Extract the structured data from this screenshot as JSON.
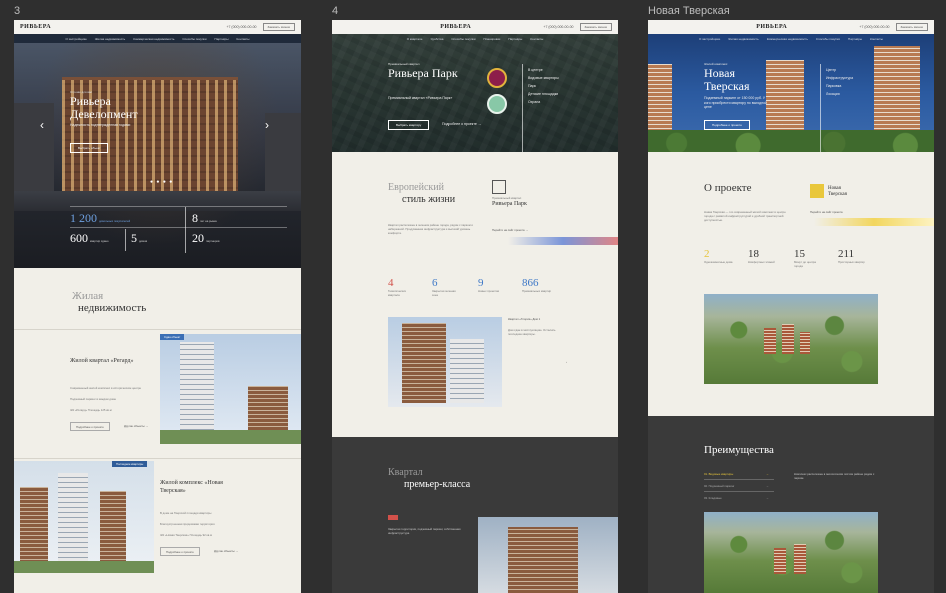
{
  "columns": [
    {
      "number": "3",
      "header": {
        "logo": "РИВЬЕРА"
      },
      "nav": [
        "О застройщике",
        "Жилая недвижимость",
        "Коммерческая недвижимость",
        "Способы покупки",
        "Партнёры",
        "Контакты"
      ],
      "hero": {
        "kicker": "Строим для вас",
        "title": "Ривьера Девелопмент",
        "subtitle": "Надежность подтвержденная годами",
        "button": "Выбрать объект",
        "arrow_left": "‹",
        "arrow_right": "›",
        "dots": "● ● ● ●"
      },
      "stats": [
        {
          "num": "1 200",
          "label": "довольных покупателей",
          "blue": true
        },
        {
          "num": "8",
          "label": "лет на рынке"
        },
        {
          "num": "600",
          "label": "квартир сдано"
        },
        {
          "num": "5",
          "label": "домов"
        },
        {
          "num": "20",
          "label": "партнеров"
        }
      ],
      "section": {
        "line1": "Жилая",
        "line2": "недвижимость"
      },
      "cards": [
        {
          "tag": "Сдан объект",
          "title": "Жилой квартал «Регард»",
          "bullets": [
            "Современный жилой комплекс в историческом центре",
            "Подземный паркинг в каждом доме",
            "ЖК «Регард» Площадь 125 кв.м"
          ],
          "button": "Подробнее о проекте",
          "more": "Другие объекты →"
        },
        {
          "tag": "Последние квартиры",
          "title": "Жилой комплекс «Новая Тверская»",
          "bullets": [
            "В доме на Тверской площади квартиры",
            "Благоустроенная придомовая территория",
            "ЖК «Новая Тверская» Площадь 92 кв.м"
          ],
          "button": "Подробнее о проекте",
          "more": "Другие объекты →"
        }
      ]
    },
    {
      "number": "4",
      "header": {
        "logo": "РИВЬЕРА"
      },
      "nav": [
        "О квартале",
        "Удобства",
        "Способы покупки",
        "Планировки",
        "Партнёры",
        "Контакты"
      ],
      "hero": {
        "kicker": "Премиальный квартал",
        "title": "Ривьера Парк",
        "subtitle": "Премиальный квартал «Ривьера Парк»",
        "button": "Выбрать квартиру",
        "link": "Подробнее о проекте →",
        "features": [
          "В центре",
          "Видовые квартиры",
          "Парк",
          "Детские площадки",
          "Охрана"
        ]
      },
      "section": {
        "line1": "Европейский",
        "line2": "стиль жизни",
        "logo_kicker": "Премиальный квартал",
        "logo_name": "Ривьера Парк",
        "link": "Перейти на сайт проекта →",
        "para": "Квартал расположен в зеленом районе города, рядом с парком и набережной. Продуманная инфраструктура и высокий уровень комфорта."
      },
      "stats": [
        {
          "num": "4",
          "label": "Тематических квартала",
          "color": "#d2514a"
        },
        {
          "num": "6",
          "label": "Закрытая зеленая зона",
          "color": "#3e78c7"
        },
        {
          "num": "9",
          "label": "Новых проектов",
          "color": "#3e78c7"
        },
        {
          "num": "866",
          "label": "Премиальных квартир",
          "color": "#3e78c7"
        }
      ],
      "house": {
        "title": "Квартал «Глория» Дом 1",
        "text": "Дом сдан в эксплуатацию. Остались последние квартиры."
      },
      "dark": {
        "line1": "Квартал",
        "line2": "премьер-класса",
        "para": "Закрытая территория, подземный паркинг, собственная инфраструктура."
      }
    },
    {
      "number": "Новая Тверская",
      "header": {
        "logo": "РИВЬЕРА"
      },
      "nav": [
        "О застройщике",
        "Жилая недвижимость",
        "Коммерческая недвижимость",
        "Способы покупки",
        "Партнёры",
        "Контакты"
      ],
      "hero": {
        "kicker": "Жилой комплекс",
        "title": "Новая Тверская",
        "subtitle": "Подземный паркинг от 150 000 руб. У кого приобрести квартиру по выгодной цене",
        "button": "Подробнее о проекте",
        "features": [
          "Центр",
          "Инфраструктура",
          "Парковка",
          "Локация"
        ]
      },
      "about": {
        "title": "О проекте",
        "logo_name": "Новая Тверская",
        "link": "Перейти на сайт проекта",
        "para": "Новая Тверская — это современный жилой комплекс в центре города с развитой инфраструктурой и удобной транспортной доступностью."
      },
      "stats": [
        {
          "num": "2",
          "label": "Однокомнатные дома",
          "yellow": true
        },
        {
          "num": "18",
          "label": "Комфортных этажей"
        },
        {
          "num": "15",
          "label": "Минут до центра города"
        },
        {
          "num": "211",
          "label": "Просторных квартир"
        }
      ],
      "advantages": {
        "title": "Преимущества",
        "items": [
          "01. Видовые квартиры",
          "02. Подземный паркинг",
          "03. Кладовые"
        ],
        "para": "Комплекс расположен в экологически чистом районе рядом с парком."
      }
    }
  ]
}
